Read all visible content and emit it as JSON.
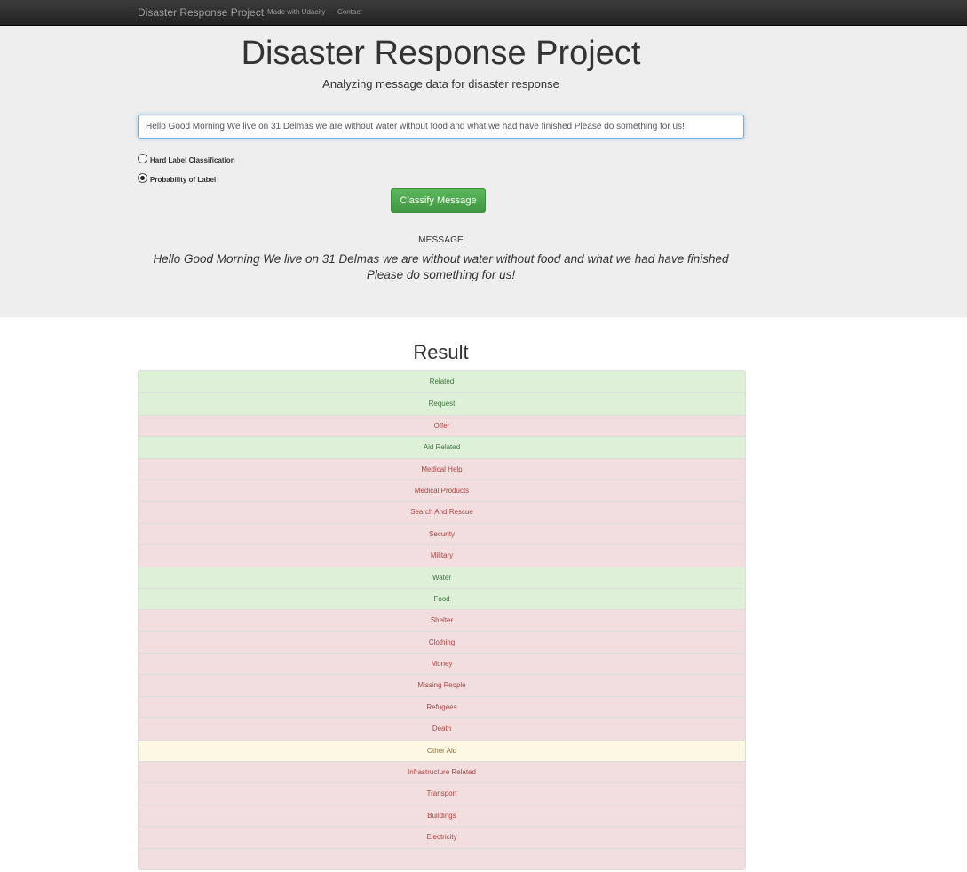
{
  "navbar": {
    "brand": "Disaster Response Project",
    "links": [
      "Made with Udacity",
      "Contact"
    ]
  },
  "header": {
    "title": "Disaster Response Project",
    "subtitle": "Analyzing message data for disaster response"
  },
  "form": {
    "query_value": "Hello Good Morning We live on 31 Delmas we are without water without food and what we had have finished Please do something for us!",
    "options": [
      {
        "label": "Hard Label Classification",
        "checked": false
      },
      {
        "label": "Probability of Label",
        "checked": true
      }
    ],
    "classify_label": "Classify Message"
  },
  "message": {
    "heading": "MESSAGE",
    "text": "Hello Good Morning We live on 31 Delmas we are without water without food and what we had have finished Please do something for us!"
  },
  "result": {
    "title": "Result",
    "items": [
      {
        "label": "Related",
        "status": "success"
      },
      {
        "label": "Request",
        "status": "success"
      },
      {
        "label": "Offer",
        "status": "danger"
      },
      {
        "label": "Aid Related",
        "status": "success"
      },
      {
        "label": "Medical Help",
        "status": "danger"
      },
      {
        "label": "Medical Products",
        "status": "danger"
      },
      {
        "label": "Search And Rescue",
        "status": "danger"
      },
      {
        "label": "Security",
        "status": "danger"
      },
      {
        "label": "Military",
        "status": "danger"
      },
      {
        "label": "Water",
        "status": "success"
      },
      {
        "label": "Food",
        "status": "success"
      },
      {
        "label": "Shelter",
        "status": "danger"
      },
      {
        "label": "Clothing",
        "status": "danger"
      },
      {
        "label": "Money",
        "status": "danger"
      },
      {
        "label": "Missing People",
        "status": "danger"
      },
      {
        "label": "Refugees",
        "status": "danger"
      },
      {
        "label": "Death",
        "status": "danger"
      },
      {
        "label": "Other Aid",
        "status": "warning"
      },
      {
        "label": "Infrastructure Related",
        "status": "danger"
      },
      {
        "label": "Transport",
        "status": "danger"
      },
      {
        "label": "Buildings",
        "status": "danger"
      },
      {
        "label": "Electricity",
        "status": "danger"
      },
      {
        "label": "",
        "status": "danger"
      }
    ]
  },
  "colors": {
    "success_bg": "#dff0d8",
    "danger_bg": "#f2dede",
    "warning_bg": "#fcf8e3",
    "button_green": "#5cb85c",
    "navbar_dark": "#222222"
  }
}
